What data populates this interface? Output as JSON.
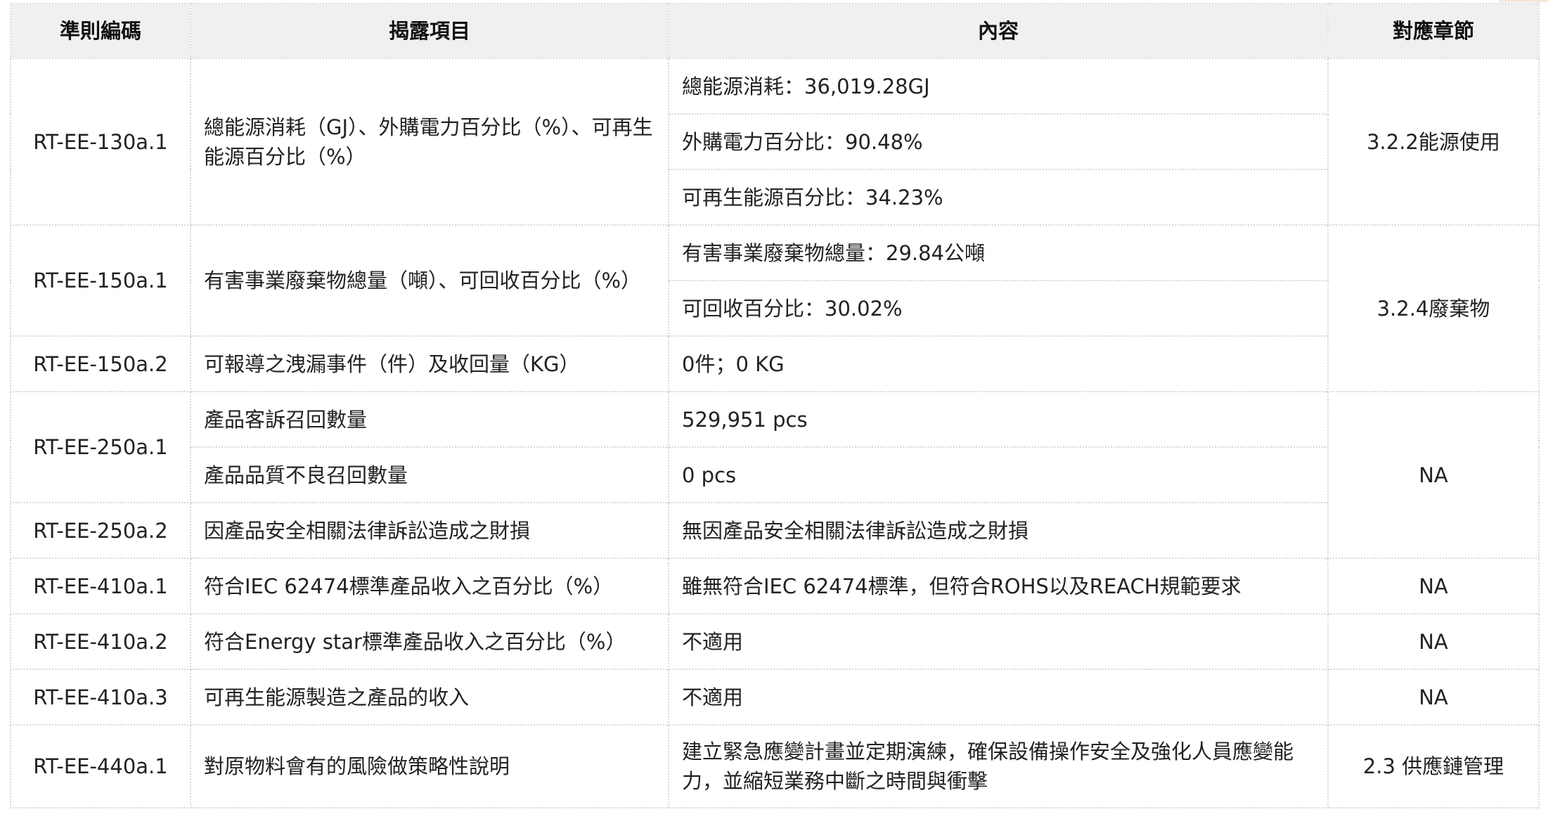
{
  "header": {
    "code": "準則編碼",
    "item": "揭露項目",
    "content": "內容",
    "section": "對應章節"
  },
  "rows": [
    {
      "code": "RT-EE-130a.1",
      "item": "總能源消耗（GJ）、外購電力百分比（%）、可再生能源百分比（%）",
      "contents": [
        "總能源消耗：36,019.28GJ",
        "外購電力百分比：90.48%",
        "可再生能源百分比：34.23%"
      ],
      "section": "3.2.2能源使用"
    },
    {
      "code": "RT-EE-150a.1",
      "item": "有害事業廢棄物總量（噸）、可回收百分比（%）",
      "contents": [
        "有害事業廢棄物總量：29.84公噸",
        "可回收百分比：30.02%"
      ],
      "section": "3.2.4廢棄物"
    },
    {
      "code": "RT-EE-150a.2",
      "item": "可報導之洩漏事件（件）及收回量（KG）",
      "contents": [
        "0件；0 KG"
      ]
    },
    {
      "code": "RT-EE-250a.1",
      "items": [
        "產品客訴召回數量",
        "產品品質不良召回數量"
      ],
      "contents": [
        "529,951 pcs",
        "0 pcs"
      ],
      "section": "NA"
    },
    {
      "code": "RT-EE-250a.2",
      "item": "因產品安全相關法律訴訟造成之財損",
      "contents": [
        "無因產品安全相關法律訴訟造成之財損"
      ]
    },
    {
      "code": "RT-EE-410a.1",
      "item": "符合IEC 62474標準產品收入之百分比（%）",
      "contents": [
        "雖無符合IEC 62474標準，但符合ROHS以及REACH規範要求"
      ],
      "section": "NA"
    },
    {
      "code": "RT-EE-410a.2",
      "item": "符合Energy star標準產品收入之百分比（%）",
      "contents": [
        "不適用"
      ],
      "section": "NA"
    },
    {
      "code": "RT-EE-410a.3",
      "item": "可再生能源製造之產品的收入",
      "contents": [
        "不適用"
      ],
      "section": "NA"
    },
    {
      "code": "RT-EE-440a.1",
      "item": "對原物料會有的風險做策略性說明",
      "contents": [
        "建立緊急應變計畫並定期演練，確保設備操作安全及強化人員應變能力，並縮短業務中斷之時間與衝擊"
      ],
      "section": "2.3 供應鏈管理"
    }
  ]
}
